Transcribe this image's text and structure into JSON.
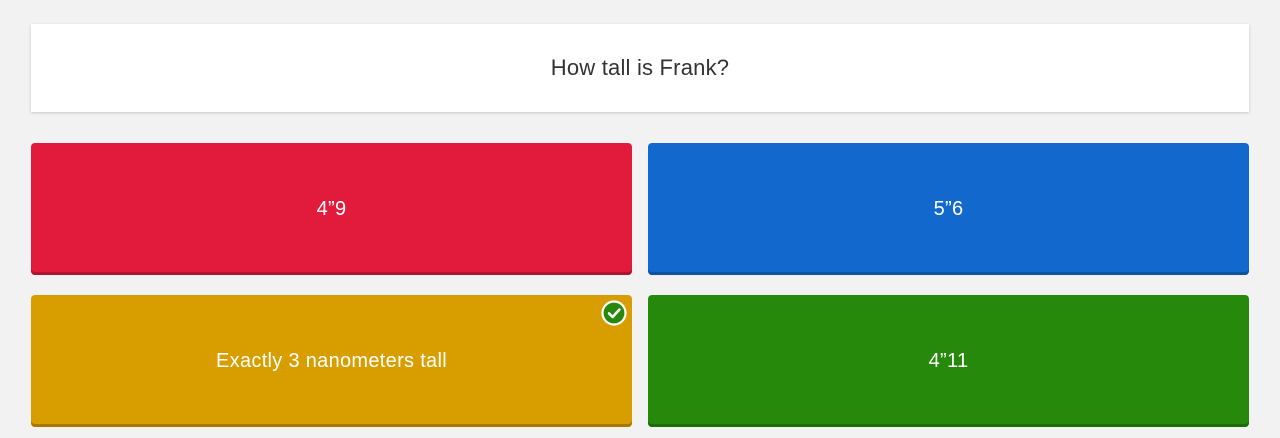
{
  "question": {
    "text": "How tall is Frank?"
  },
  "answers": [
    {
      "label": "4”9",
      "color": "#e21b3c",
      "correct": false
    },
    {
      "label": "5”6",
      "color": "#1368ce",
      "correct": false
    },
    {
      "label": "Exactly 3 nanometers tall",
      "color": "#d89e00",
      "correct": true,
      "icon": "check-circle-icon"
    },
    {
      "label": "4”11",
      "color": "#26890c",
      "correct": false
    }
  ]
}
